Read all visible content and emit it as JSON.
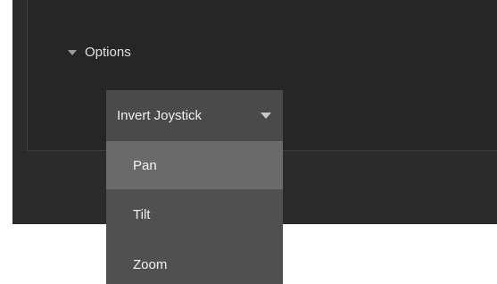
{
  "options": {
    "label": "Options",
    "toggle_icon": "triangle-down-icon"
  },
  "select": {
    "value": "Invert Joystick",
    "arrow_icon": "chevron-down-icon"
  },
  "menu": {
    "items": [
      {
        "label": "Pan"
      },
      {
        "label": "Tilt"
      },
      {
        "label": "Zoom"
      }
    ],
    "highlighted": "Pan"
  },
  "colors": {
    "panel": "#2b2b2b",
    "select_bg": "#4a4a4a",
    "menu_bg": "#505050",
    "highlight_bg": "#6a6a6a"
  }
}
